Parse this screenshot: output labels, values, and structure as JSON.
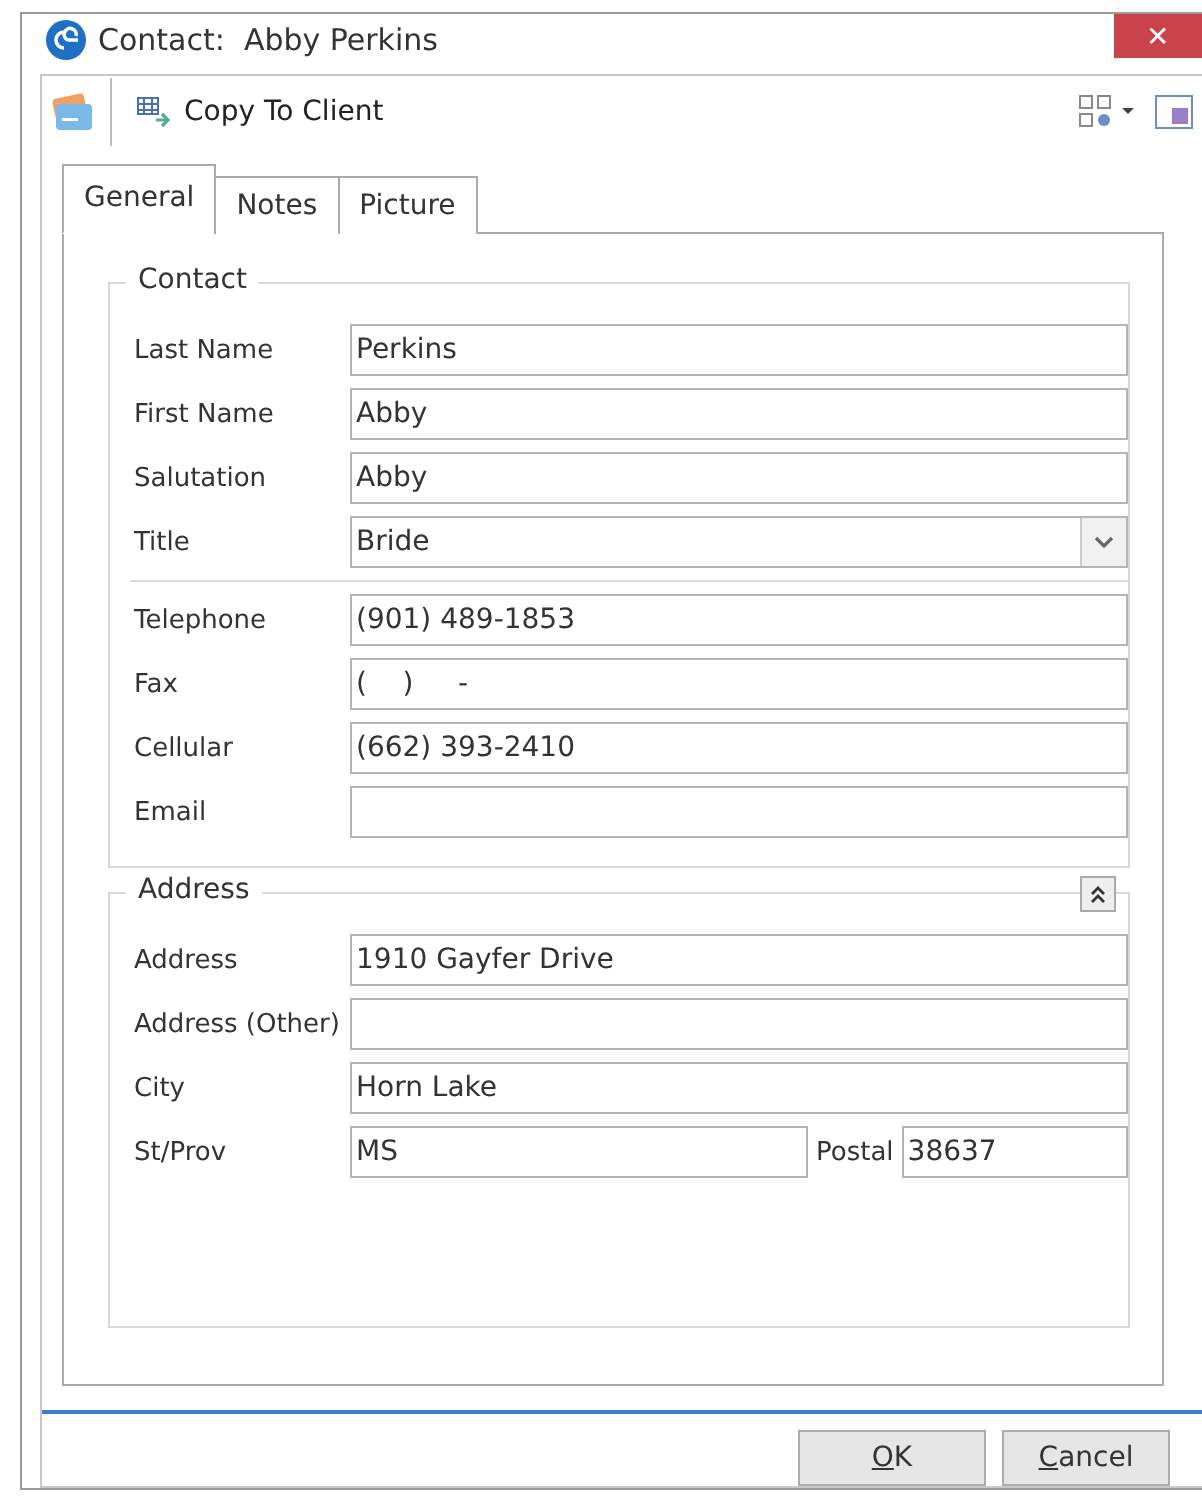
{
  "window": {
    "title": "Contact:  Abby Perkins",
    "close": "✕"
  },
  "toolbar": {
    "buttons": [
      {
        "label": "Copy To Client"
      }
    ]
  },
  "tabs": [
    {
      "label": "General",
      "selected": true
    },
    {
      "label": "Notes",
      "selected": false
    },
    {
      "label": "Picture",
      "selected": false
    }
  ],
  "groups": [
    {
      "title": "Contact",
      "collapsible": false,
      "rows": [
        {
          "kind": "text",
          "label": "Last Name",
          "value": "Perkins"
        },
        {
          "kind": "text",
          "label": "First Name",
          "value": "Abby"
        },
        {
          "kind": "text",
          "label": "Salutation",
          "value": "Abby"
        },
        {
          "kind": "select",
          "label": "Title",
          "value": "Bride"
        },
        {
          "kind": "divider"
        },
        {
          "kind": "text",
          "label": "Telephone",
          "value": "(901) 489-1853"
        },
        {
          "kind": "text",
          "label": "Fax",
          "value": "(    )     -"
        },
        {
          "kind": "text",
          "label": "Cellular",
          "value": "(662) 393-2410"
        },
        {
          "kind": "text",
          "label": "Email",
          "value": ""
        }
      ]
    },
    {
      "title": "Address",
      "collapsible": true,
      "rows": [
        {
          "kind": "text",
          "label": "Address",
          "value": "1910 Gayfer Drive"
        },
        {
          "kind": "text",
          "label": "Address (Other)",
          "value": ""
        },
        {
          "kind": "text",
          "label": "City",
          "value": "Horn Lake"
        },
        {
          "kind": "pair",
          "label": "St/Prov",
          "value": "MS",
          "label_2": "Postal",
          "value_2": "38637"
        }
      ]
    }
  ],
  "buttons": [
    {
      "label": "OK",
      "mnemonic": true
    },
    {
      "label": "Cancel",
      "mnemonic": true
    }
  ]
}
